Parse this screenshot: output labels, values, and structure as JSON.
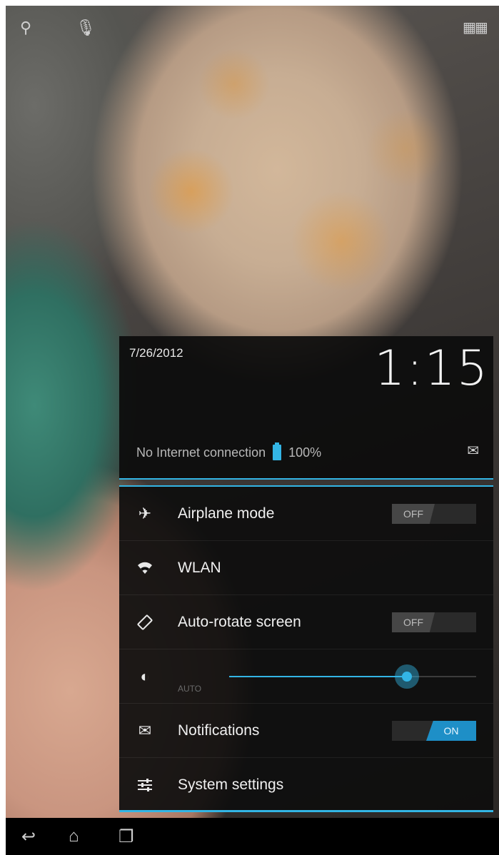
{
  "status_header": {
    "date": "7/26/2012",
    "time": "1:15",
    "connection": "No Internet connection",
    "battery_level": "100%"
  },
  "quick_settings": {
    "airplane": {
      "label": "Airplane mode",
      "state": "OFF"
    },
    "wlan": {
      "label": "WLAN"
    },
    "auto_rotate": {
      "label": "Auto-rotate screen",
      "state": "OFF"
    },
    "brightness": {
      "auto_label": "AUTO",
      "level_fraction": 0.72
    },
    "notifications": {
      "label": "Notifications",
      "state": "ON"
    },
    "system_settings": {
      "label": "System settings"
    }
  },
  "icons": [
    "search-icon",
    "mic-icon",
    "apps-grid-icon",
    "battery-icon",
    "notifications-icon",
    "airplane-icon",
    "wifi-icon",
    "rotate-icon",
    "brightness-icon",
    "settings-sliders-icon",
    "back-icon",
    "home-icon",
    "recent-apps-icon"
  ],
  "colors": {
    "accent": "#33b5e5",
    "panel": "#0e0e0e",
    "toggle_on": "#1e8fc7"
  }
}
